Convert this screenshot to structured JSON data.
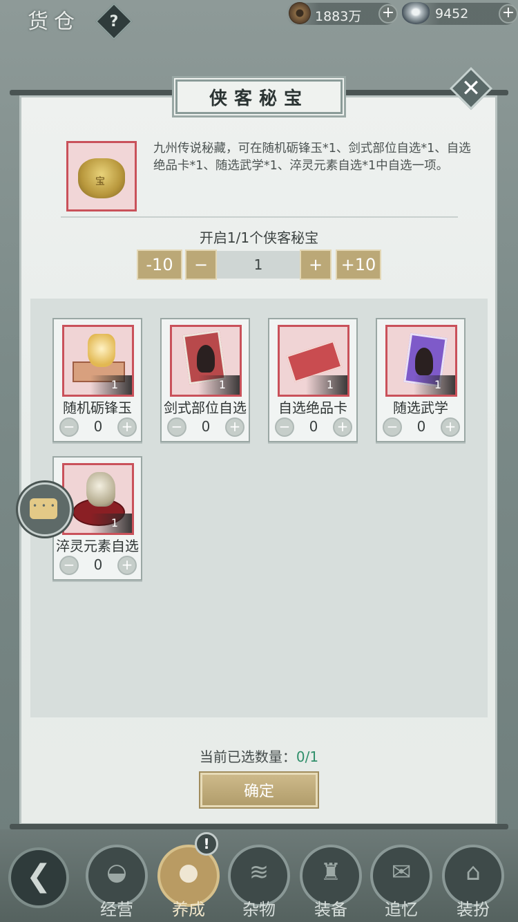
{
  "header": {
    "title": "货仓",
    "help_label": "?",
    "currencies": [
      {
        "icon": "copper-coin-icon",
        "value": "1883万",
        "add": "+"
      },
      {
        "icon": "silver-ingot-icon",
        "value": "9452",
        "add": "+"
      }
    ]
  },
  "dialog": {
    "title": "侠客秘宝",
    "close_label": "✕",
    "item": {
      "icon": "treasure-pot-icon",
      "mark": "宝",
      "description": "九州传说秘藏，可在随机砺锋玉*1、剑式部位自选*1、自选绝品卡*1、随选武学*1、淬灵元素自选*1中自选一项。"
    },
    "open_label": "开启1/1个侠客秘宝",
    "quantity": {
      "minus10": "-10",
      "minus": "−",
      "value": "1",
      "plus": "+",
      "plus10": "+10"
    },
    "rewards": [
      {
        "name": "随机砺锋玉",
        "count": "1",
        "selected": "0",
        "icon": "jade-stone-icon"
      },
      {
        "name": "剑式部位自选",
        "count": "1",
        "selected": "0",
        "icon": "sword-card-icon"
      },
      {
        "name": "自选绝品卡",
        "count": "1",
        "selected": "0",
        "icon": "premium-card-icon"
      },
      {
        "name": "随选武学",
        "count": "1",
        "selected": "0",
        "icon": "martial-card-icon"
      },
      {
        "name": "淬灵元素自选",
        "count": "1",
        "selected": "0",
        "icon": "element-stone-icon"
      }
    ],
    "stepper": {
      "minus": "−",
      "plus": "+"
    },
    "selected_label": "当前已选数量：",
    "selected_value": "0/1",
    "confirm_label": "确定"
  },
  "bottom_nav": {
    "back_label": "❮",
    "alert_label": "!",
    "items": [
      {
        "label": "经营",
        "icon": "bowl-icon",
        "glyph": "◒"
      },
      {
        "label": "养成",
        "icon": "pearl-icon",
        "glyph": "●"
      },
      {
        "label": "杂物",
        "icon": "sticks-icon",
        "glyph": "≋"
      },
      {
        "label": "装备",
        "icon": "robe-icon",
        "glyph": "♜"
      },
      {
        "label": "追忆",
        "icon": "letter-icon",
        "glyph": "✉"
      },
      {
        "label": "装扮",
        "icon": "pavilion-icon",
        "glyph": "⌂"
      }
    ]
  }
}
